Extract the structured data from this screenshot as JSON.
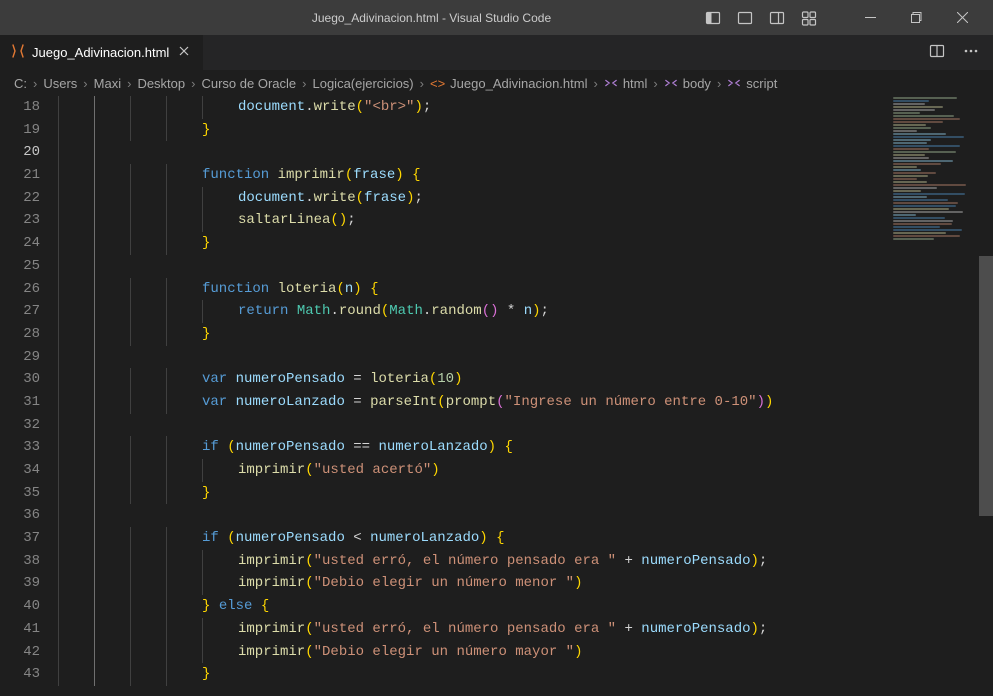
{
  "window": {
    "title": "Juego_Adivinacion.html - Visual Studio Code"
  },
  "tabs": [
    {
      "label": "Juego_Adivinacion.html",
      "active": true
    }
  ],
  "breadcrumbs": {
    "path": [
      "C:",
      "Users",
      "Maxi",
      "Desktop",
      "Curso de Oracle",
      "Logica(ejercicios)"
    ],
    "file": "Juego_Adivinacion.html",
    "symbols": [
      "html",
      "body",
      "script"
    ]
  },
  "editor": {
    "first_line": 18,
    "current_line": 20,
    "lines": [
      {
        "n": 18,
        "indent": 5,
        "tokens": [
          [
            "id",
            "document"
          ],
          [
            "punc",
            "."
          ],
          [
            "fn",
            "write"
          ],
          [
            "paren",
            "("
          ],
          [
            "str",
            "\"<br>\""
          ],
          [
            "paren",
            ")"
          ],
          [
            "punc",
            ";"
          ]
        ]
      },
      {
        "n": 19,
        "indent": 4,
        "tokens": [
          [
            "paren",
            "}"
          ]
        ]
      },
      {
        "n": 20,
        "indent": 0,
        "tokens": []
      },
      {
        "n": 21,
        "indent": 4,
        "tokens": [
          [
            "kw",
            "function"
          ],
          [
            "punc",
            " "
          ],
          [
            "fn",
            "imprimir"
          ],
          [
            "paren",
            "("
          ],
          [
            "id",
            "frase"
          ],
          [
            "paren",
            ")"
          ],
          [
            "punc",
            " "
          ],
          [
            "paren",
            "{"
          ]
        ]
      },
      {
        "n": 22,
        "indent": 5,
        "tokens": [
          [
            "id",
            "document"
          ],
          [
            "punc",
            "."
          ],
          [
            "fn",
            "write"
          ],
          [
            "paren",
            "("
          ],
          [
            "id",
            "frase"
          ],
          [
            "paren",
            ")"
          ],
          [
            "punc",
            ";"
          ]
        ]
      },
      {
        "n": 23,
        "indent": 5,
        "tokens": [
          [
            "fn",
            "saltarLinea"
          ],
          [
            "paren",
            "("
          ],
          [
            "paren",
            ")"
          ],
          [
            "punc",
            ";"
          ]
        ]
      },
      {
        "n": 24,
        "indent": 4,
        "tokens": [
          [
            "paren",
            "}"
          ]
        ]
      },
      {
        "n": 25,
        "indent": 0,
        "tokens": []
      },
      {
        "n": 26,
        "indent": 4,
        "tokens": [
          [
            "kw",
            "function"
          ],
          [
            "punc",
            " "
          ],
          [
            "fn",
            "loteria"
          ],
          [
            "paren",
            "("
          ],
          [
            "id",
            "n"
          ],
          [
            "paren",
            ")"
          ],
          [
            "punc",
            " "
          ],
          [
            "paren",
            "{"
          ]
        ]
      },
      {
        "n": 27,
        "indent": 5,
        "tokens": [
          [
            "kw",
            "return"
          ],
          [
            "punc",
            " "
          ],
          [
            "type",
            "Math"
          ],
          [
            "punc",
            "."
          ],
          [
            "fn",
            "round"
          ],
          [
            "paren",
            "("
          ],
          [
            "type",
            "Math"
          ],
          [
            "punc",
            "."
          ],
          [
            "fn",
            "random"
          ],
          [
            "paren2",
            "("
          ],
          [
            "paren2",
            ")"
          ],
          [
            "punc",
            " * "
          ],
          [
            "id",
            "n"
          ],
          [
            "paren",
            ")"
          ],
          [
            "punc",
            ";"
          ]
        ]
      },
      {
        "n": 28,
        "indent": 4,
        "tokens": [
          [
            "paren",
            "}"
          ]
        ]
      },
      {
        "n": 29,
        "indent": 0,
        "tokens": []
      },
      {
        "n": 30,
        "indent": 4,
        "tokens": [
          [
            "kw",
            "var"
          ],
          [
            "punc",
            " "
          ],
          [
            "id",
            "numeroPensado"
          ],
          [
            "punc",
            " = "
          ],
          [
            "fn",
            "loteria"
          ],
          [
            "paren",
            "("
          ],
          [
            "num",
            "10"
          ],
          [
            "paren",
            ")"
          ]
        ]
      },
      {
        "n": 31,
        "indent": 4,
        "tokens": [
          [
            "kw",
            "var"
          ],
          [
            "punc",
            " "
          ],
          [
            "id",
            "numeroLanzado"
          ],
          [
            "punc",
            " = "
          ],
          [
            "fn",
            "parseInt"
          ],
          [
            "paren",
            "("
          ],
          [
            "fn",
            "prompt"
          ],
          [
            "paren2",
            "("
          ],
          [
            "str",
            "\"Ingrese un número entre 0-10\""
          ],
          [
            "paren2",
            ")"
          ],
          [
            "paren",
            ")"
          ]
        ]
      },
      {
        "n": 32,
        "indent": 0,
        "tokens": []
      },
      {
        "n": 33,
        "indent": 4,
        "tokens": [
          [
            "kw",
            "if"
          ],
          [
            "punc",
            " "
          ],
          [
            "paren",
            "("
          ],
          [
            "id",
            "numeroPensado"
          ],
          [
            "punc",
            " == "
          ],
          [
            "id",
            "numeroLanzado"
          ],
          [
            "paren",
            ")"
          ],
          [
            "punc",
            " "
          ],
          [
            "paren",
            "{"
          ]
        ]
      },
      {
        "n": 34,
        "indent": 5,
        "tokens": [
          [
            "fn",
            "imprimir"
          ],
          [
            "paren",
            "("
          ],
          [
            "str",
            "\"usted acertó\""
          ],
          [
            "paren",
            ")"
          ]
        ]
      },
      {
        "n": 35,
        "indent": 4,
        "tokens": [
          [
            "paren",
            "}"
          ]
        ]
      },
      {
        "n": 36,
        "indent": 0,
        "tokens": []
      },
      {
        "n": 37,
        "indent": 4,
        "tokens": [
          [
            "kw",
            "if"
          ],
          [
            "punc",
            " "
          ],
          [
            "paren",
            "("
          ],
          [
            "id",
            "numeroPensado"
          ],
          [
            "punc",
            " < "
          ],
          [
            "id",
            "numeroLanzado"
          ],
          [
            "paren",
            ")"
          ],
          [
            "punc",
            " "
          ],
          [
            "paren",
            "{"
          ]
        ]
      },
      {
        "n": 38,
        "indent": 5,
        "tokens": [
          [
            "fn",
            "imprimir"
          ],
          [
            "paren",
            "("
          ],
          [
            "str",
            "\"usted erró, el número pensado era \""
          ],
          [
            "punc",
            " + "
          ],
          [
            "id",
            "numeroPensado"
          ],
          [
            "paren",
            ")"
          ],
          [
            "punc",
            ";"
          ]
        ]
      },
      {
        "n": 39,
        "indent": 5,
        "tokens": [
          [
            "fn",
            "imprimir"
          ],
          [
            "paren",
            "("
          ],
          [
            "str",
            "\"Debio elegir un número menor \""
          ],
          [
            "paren",
            ")"
          ]
        ]
      },
      {
        "n": 40,
        "indent": 4,
        "tokens": [
          [
            "paren",
            "}"
          ],
          [
            "punc",
            " "
          ],
          [
            "kw",
            "else"
          ],
          [
            "punc",
            " "
          ],
          [
            "paren",
            "{"
          ]
        ]
      },
      {
        "n": 41,
        "indent": 5,
        "tokens": [
          [
            "fn",
            "imprimir"
          ],
          [
            "paren",
            "("
          ],
          [
            "str",
            "\"usted erró, el número pensado era \""
          ],
          [
            "punc",
            " + "
          ],
          [
            "id",
            "numeroPensado"
          ],
          [
            "paren",
            ")"
          ],
          [
            "punc",
            ";"
          ]
        ]
      },
      {
        "n": 42,
        "indent": 5,
        "tokens": [
          [
            "fn",
            "imprimir"
          ],
          [
            "paren",
            "("
          ],
          [
            "str",
            "\"Debio elegir un número mayor \""
          ],
          [
            "paren",
            ")"
          ]
        ]
      },
      {
        "n": 43,
        "indent": 4,
        "tokens": [
          [
            "paren",
            "}"
          ]
        ]
      }
    ]
  },
  "minimap_colors": [
    "#569cd6",
    "#dcdcaa",
    "#9cdcfe",
    "#ce9178",
    "#d4d4d4",
    "#b5cea8"
  ]
}
